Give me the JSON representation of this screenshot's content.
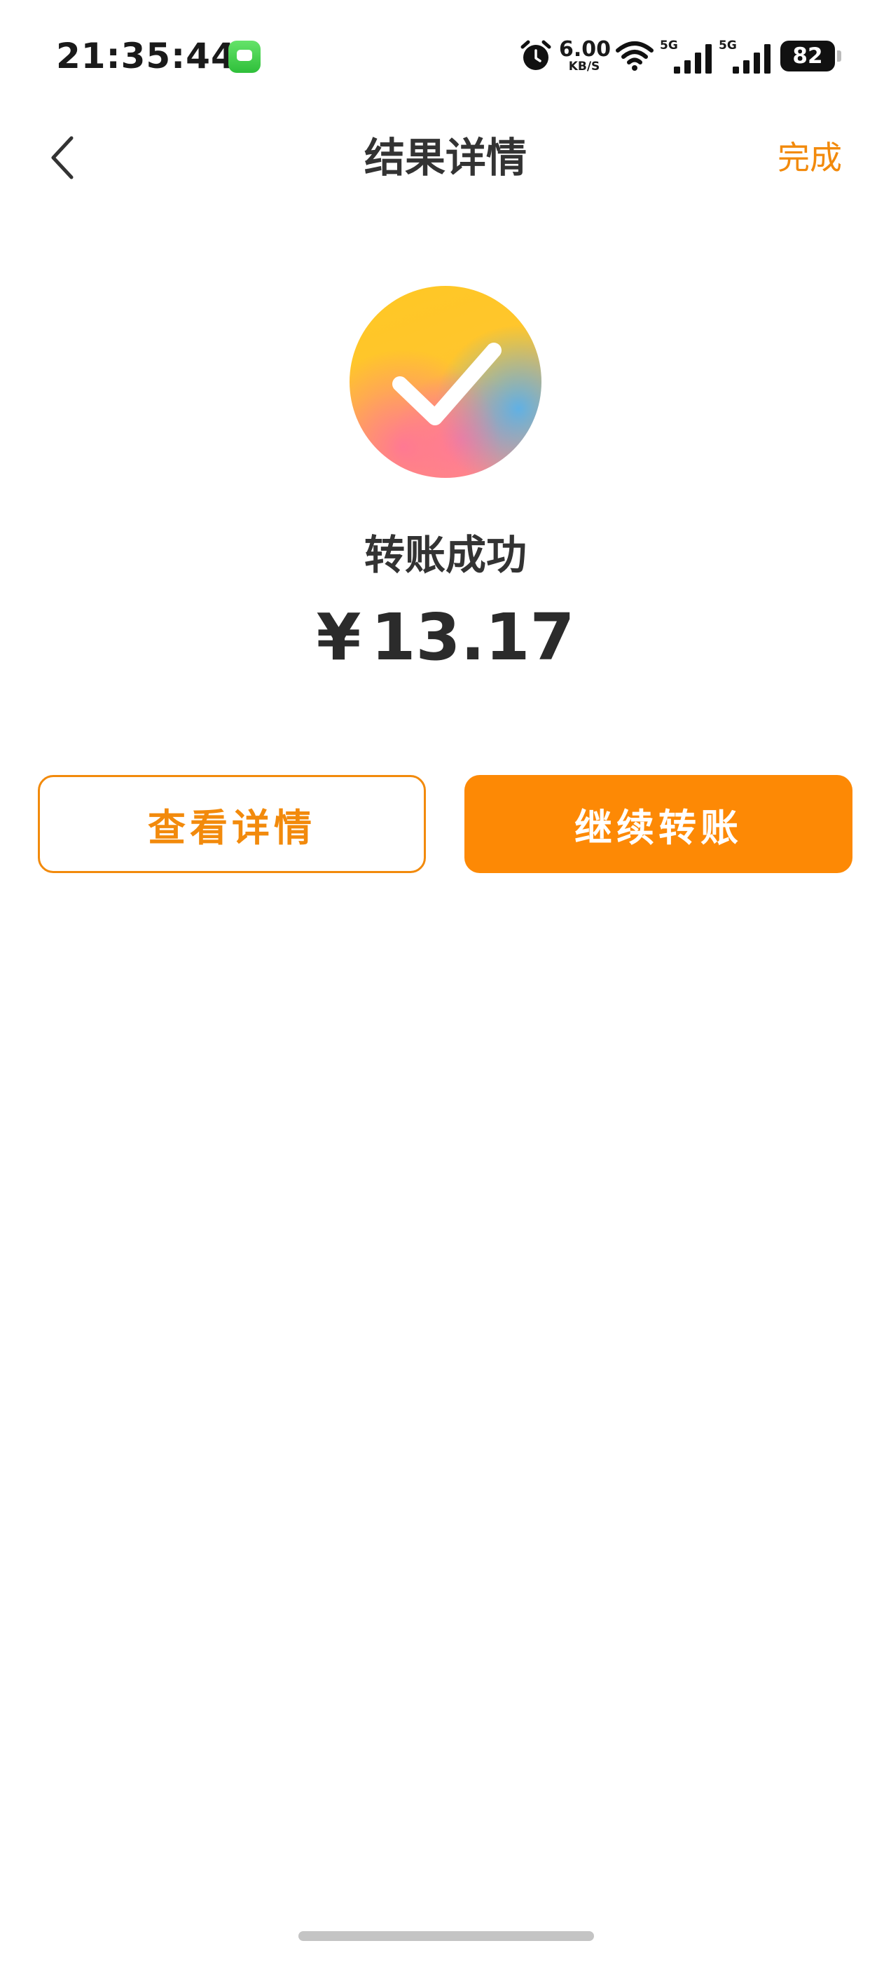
{
  "status_bar": {
    "time": "21:35:44",
    "net_speed": "6.00",
    "net_unit": "KB/S",
    "sim1": "5G",
    "sim2": "5G",
    "battery": "82"
  },
  "nav": {
    "title": "结果详情",
    "done_label": "完成"
  },
  "result": {
    "status": "转账成功",
    "currency": "¥",
    "amount": "13.17"
  },
  "actions": {
    "view_details": "查看详情",
    "continue_transfer": "继续转账"
  },
  "colors": {
    "accent": "#fd8905",
    "accent_text": "#f28a0c"
  }
}
